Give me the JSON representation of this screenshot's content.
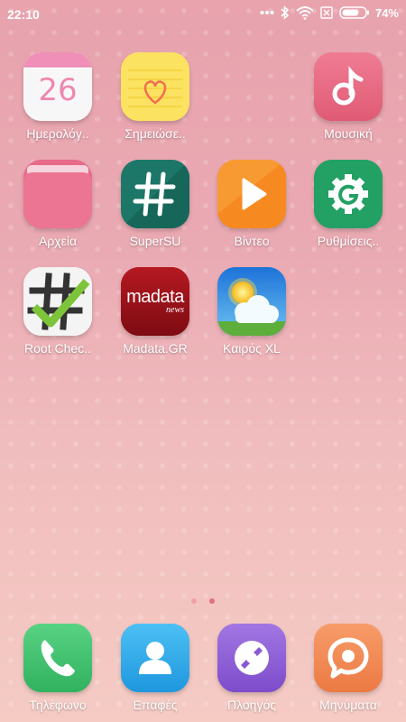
{
  "status_bar": {
    "time": "22:10",
    "battery_percent_text": "74%",
    "battery_level": 0.74,
    "icons": [
      "more-dots-icon",
      "bluetooth-icon",
      "wifi-icon",
      "no-sim-icon",
      "battery-icon"
    ]
  },
  "calendar_day": "26",
  "madata_logo": {
    "main": "madata",
    "sub": "news"
  },
  "apps": [
    {
      "label": "Ημερολόγ..",
      "icon": "calendar-icon"
    },
    {
      "label": "Σημειώσε..",
      "icon": "notes-icon"
    },
    {
      "label": "Μουσική",
      "icon": "music-icon"
    },
    {
      "label": "Αρχεία",
      "icon": "files-icon"
    },
    {
      "label": "SuperSU",
      "icon": "supersu-icon"
    },
    {
      "label": "Βίντεο",
      "icon": "video-icon"
    },
    {
      "label": "Ρυθμίσεις..",
      "icon": "google-settings-icon"
    },
    {
      "label": "Root Chec..",
      "icon": "root-checker-icon"
    },
    {
      "label": "Madata.GR",
      "icon": "madata-icon"
    },
    {
      "label": "Καιρός XL",
      "icon": "weather-icon"
    }
  ],
  "page_indicator": {
    "pages": 2,
    "current": 2
  },
  "dock": [
    {
      "label": "Τηλέφωνο",
      "icon": "phone-icon"
    },
    {
      "label": "Επαφές",
      "icon": "contacts-icon"
    },
    {
      "label": "Πλοηγός",
      "icon": "browser-icon"
    },
    {
      "label": "Μηνύματα",
      "icon": "messages-icon"
    }
  ]
}
